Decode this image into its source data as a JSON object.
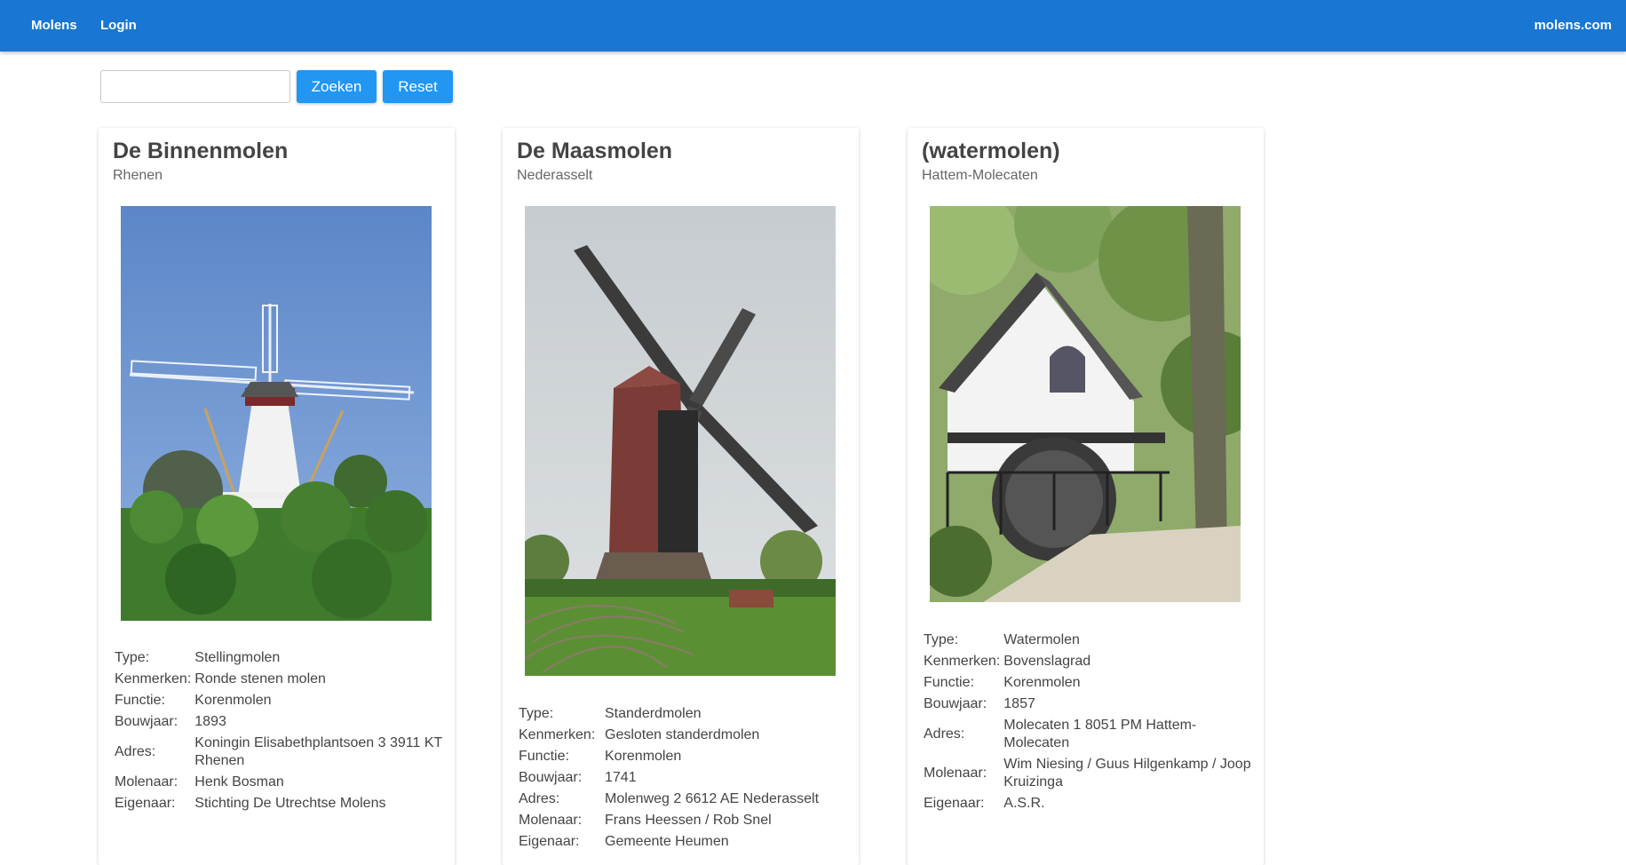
{
  "nav": {
    "items": [
      "Molens",
      "Login"
    ],
    "brand": "molens.com"
  },
  "search": {
    "value": "",
    "placeholder": "",
    "search_label": "Zoeken",
    "reset_label": "Reset"
  },
  "cards": [
    {
      "title": "De Binnenmolen",
      "place": "Rhenen",
      "details": [
        {
          "label": "Type:",
          "value": "Stellingmolen"
        },
        {
          "label": "Kenmerken:",
          "value": "Ronde stenen molen"
        },
        {
          "label": "Functie:",
          "value": "Korenmolen"
        },
        {
          "label": "Bouwjaar:",
          "value": "1893"
        },
        {
          "label": "Adres:",
          "value": "Koningin Elisabethplantsoen 3 3911 KT Rhenen"
        },
        {
          "label": "Molenaar:",
          "value": "Henk Bosman"
        },
        {
          "label": "Eigenaar:",
          "value": "Stichting De Utrechtse Molens"
        }
      ]
    },
    {
      "title": "De Maasmolen",
      "place": "Nederasselt",
      "details": [
        {
          "label": "Type:",
          "value": "Standerdmolen"
        },
        {
          "label": "Kenmerken:",
          "value": "Gesloten standerdmolen"
        },
        {
          "label": "Functie:",
          "value": "Korenmolen"
        },
        {
          "label": "Bouwjaar:",
          "value": "1741"
        },
        {
          "label": "Adres:",
          "value": "Molenweg 2 6612 AE Nederasselt"
        },
        {
          "label": "Molenaar:",
          "value": "Frans Heessen / Rob Snel"
        },
        {
          "label": "Eigenaar:",
          "value": "Gemeente Heumen"
        }
      ]
    },
    {
      "title": "(watermolen)",
      "place": "Hattem-Molecaten",
      "details": [
        {
          "label": "Type:",
          "value": "Watermolen"
        },
        {
          "label": "Kenmerken:",
          "value": "Bovenslagrad"
        },
        {
          "label": "Functie:",
          "value": "Korenmolen"
        },
        {
          "label": "Bouwjaar:",
          "value": "1857"
        },
        {
          "label": "Adres:",
          "value": "Molecaten 1 8051 PM Hattem-Molecaten"
        },
        {
          "label": "Molenaar:",
          "value": "Wim Niesing / Guus Hilgenkamp / Joop Kruizinga"
        },
        {
          "label": "Eigenaar:",
          "value": "A.S.R."
        }
      ]
    }
  ],
  "colors": {
    "navbar": "#1976d2",
    "button": "#2196f3"
  }
}
